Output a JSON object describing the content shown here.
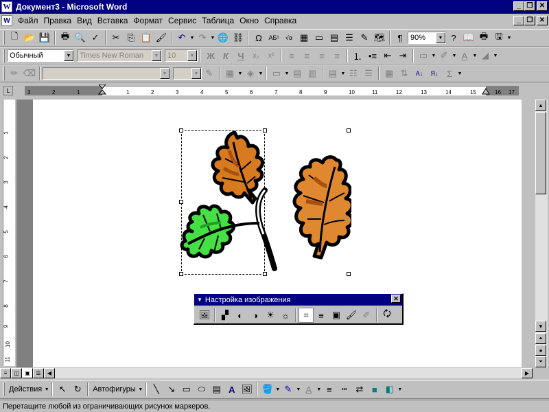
{
  "window": {
    "title": "Документ3 - Microsoft Word",
    "app_icon": "word-icon"
  },
  "menu": [
    "Файл",
    "Правка",
    "Вид",
    "Вставка",
    "Формат",
    "Сервис",
    "Таблица",
    "Окно",
    "Справка"
  ],
  "standard_toolbar": {
    "zoom": "90%"
  },
  "format_toolbar": {
    "style": "Обычный",
    "font": "Times New Roman",
    "size": "10",
    "bold": "Ж",
    "italic": "К",
    "underline": "Ч"
  },
  "ruler": {
    "h_ticks": [
      "3",
      "2",
      "1",
      "1",
      "2",
      "3",
      "4",
      "5",
      "6",
      "7",
      "8",
      "9",
      "10",
      "11",
      "12",
      "13",
      "14",
      "15",
      "16",
      "17"
    ],
    "v_ticks": [
      "1",
      "2",
      "3",
      "4",
      "5",
      "6",
      "7",
      "8",
      "9",
      "10",
      "11"
    ]
  },
  "picture_toolbar": {
    "title": "Настройка изображения"
  },
  "drawing_toolbar": {
    "actions": "Действия",
    "autoshapes": "Автофигуры"
  },
  "status": {
    "text": "Перетащите любой из ограничивающих рисунок маркеров."
  },
  "colors": {
    "title_bar": "#000080",
    "leaf_orange": "#d87a20",
    "leaf_dark": "#a85010",
    "leaf_green": "#44e044"
  }
}
